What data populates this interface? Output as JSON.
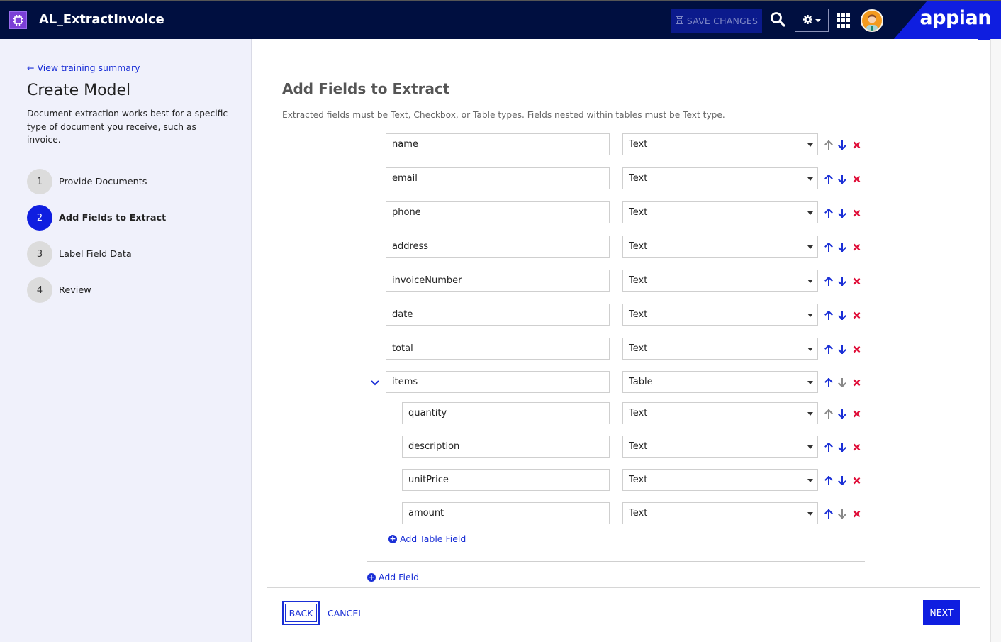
{
  "header": {
    "app_title": "AL_ExtractInvoice",
    "save_label": "SAVE CHANGES",
    "brand": "appian",
    "icons": [
      "app-chip-icon",
      "save-disk-icon",
      "search-icon",
      "gear-icon",
      "grid-icon",
      "user-avatar"
    ]
  },
  "sidebar": {
    "back_link": "View training summary",
    "title": "Create Model",
    "description": "Document extraction works best for a specific type of document you receive, such as invoice.",
    "steps": [
      {
        "num": "1",
        "label": "Provide Documents",
        "active": false
      },
      {
        "num": "2",
        "label": "Add Fields to Extract",
        "active": true
      },
      {
        "num": "3",
        "label": "Label Field Data",
        "active": false
      },
      {
        "num": "4",
        "label": "Review",
        "active": false
      }
    ]
  },
  "main": {
    "title": "Add Fields to Extract",
    "description": "Extracted fields must be Text, Checkbox, or Table types. Fields nested within tables must be Text type.",
    "fields": [
      {
        "name": "name",
        "type": "Text",
        "nested": false,
        "up_enabled": false,
        "down_enabled": true
      },
      {
        "name": "email",
        "type": "Text",
        "nested": false,
        "up_enabled": true,
        "down_enabled": true
      },
      {
        "name": "phone",
        "type": "Text",
        "nested": false,
        "up_enabled": true,
        "down_enabled": true
      },
      {
        "name": "address",
        "type": "Text",
        "nested": false,
        "up_enabled": true,
        "down_enabled": true
      },
      {
        "name": "invoiceNumber",
        "type": "Text",
        "nested": false,
        "up_enabled": true,
        "down_enabled": true
      },
      {
        "name": "date",
        "type": "Text",
        "nested": false,
        "up_enabled": true,
        "down_enabled": true
      },
      {
        "name": "total",
        "type": "Text",
        "nested": false,
        "up_enabled": true,
        "down_enabled": true
      },
      {
        "name": "items",
        "type": "Table",
        "nested": false,
        "expandable": true,
        "up_enabled": true,
        "down_enabled": false
      },
      {
        "name": "quantity",
        "type": "Text",
        "nested": true,
        "up_enabled": false,
        "down_enabled": true
      },
      {
        "name": "description",
        "type": "Text",
        "nested": true,
        "up_enabled": true,
        "down_enabled": true
      },
      {
        "name": "unitPrice",
        "type": "Text",
        "nested": true,
        "up_enabled": true,
        "down_enabled": true
      },
      {
        "name": "amount",
        "type": "Text",
        "nested": true,
        "up_enabled": true,
        "down_enabled": false
      }
    ],
    "add_table_field": "Add Table Field",
    "add_field": "Add Field"
  },
  "footer": {
    "back_label": "BACK",
    "cancel_label": "CANCEL",
    "next_label": "NEXT"
  },
  "colors": {
    "header_bg": "#000f40",
    "accent": "#0f1ee0",
    "link": "#1a2fd6",
    "delete": "#e0103a",
    "disabled": "#888888",
    "sidebar_bg": "#f0f1fb"
  }
}
